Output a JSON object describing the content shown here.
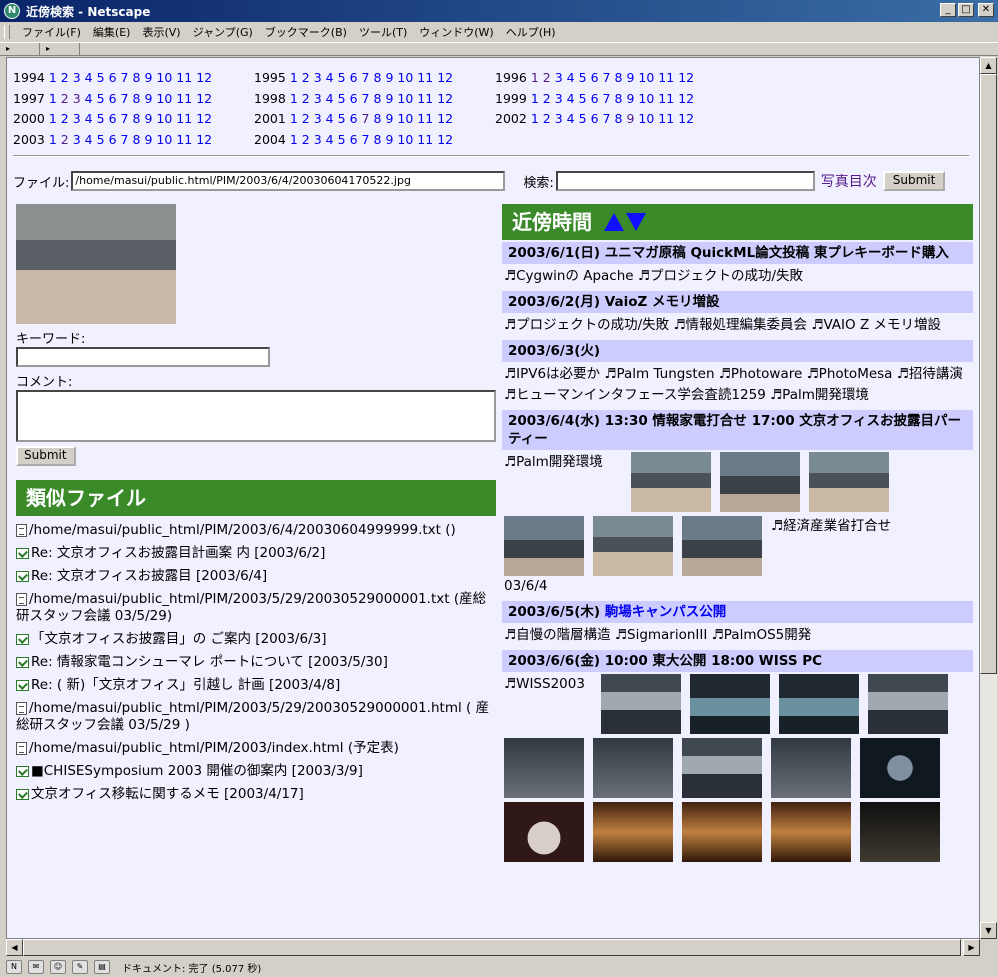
{
  "window": {
    "title": "近傍検索 - Netscape",
    "app_icon": "N"
  },
  "menu": [
    "ファイル(F)",
    "編集(E)",
    "表示(V)",
    "ジャンプ(G)",
    "ブックマーク(B)",
    "ツール(T)",
    "ウィンドウ(W)",
    "ヘルプ(H)"
  ],
  "years": [
    [
      {
        "year": "1994"
      },
      {
        "year": "1995"
      },
      {
        "year": "1996"
      }
    ],
    [
      {
        "year": "1997"
      },
      {
        "year": "1998"
      },
      {
        "year": "1999"
      }
    ],
    [
      {
        "year": "2000"
      },
      {
        "year": "2001"
      },
      {
        "year": "2002"
      }
    ],
    [
      {
        "year": "2003"
      },
      {
        "year": "2004"
      }
    ]
  ],
  "months": [
    "1",
    "2",
    "3",
    "4",
    "5",
    "6",
    "7",
    "8",
    "9",
    "10",
    "11",
    "12"
  ],
  "form": {
    "file_label": "ファイル:",
    "file_value": "/home/masui/public.html/PIM/2003/6/4/20030604170522.jpg",
    "search_label": "検索:",
    "search_value": "",
    "photo_index": "写真目次",
    "submit": "Submit"
  },
  "left": {
    "keyword_label": "キーワード:",
    "keyword_value": "",
    "comment_label": "コメント:",
    "comment_value": "",
    "submit": "Submit",
    "similar_title": "類似ファイル",
    "similar": [
      {
        "icon": "doc",
        "text": "/home/masui/public_html/PIM/2003/6/4/20030604999999.txt ()"
      },
      {
        "icon": "mail",
        "text": "Re: 文京オフィスお披露目計画案 内 [2003/6/2]"
      },
      {
        "icon": "mail",
        "text": "Re: 文京オフィスお披露目 [2003/6/4]"
      },
      {
        "icon": "doc",
        "text": "/home/masui/public_html/PIM/2003/5/29/20030529000001.txt (産総研スタッフ会議 03/5/29)"
      },
      {
        "icon": "mail",
        "text": "「文京オフィスお披露目」の ご案内 [2003/6/3]"
      },
      {
        "icon": "mail",
        "text": "Re: 情報家電コンシューマレ ポートについて [2003/5/30]"
      },
      {
        "icon": "mail",
        "text": "Re: ( 新)「文京オフィス」引越し 計画 [2003/4/8]"
      },
      {
        "icon": "doc",
        "text": "/home/masui/public_html/PIM/2003/5/29/20030529000001.html ( 産総研スタッフ会議 03/5/29 )"
      },
      {
        "icon": "doc",
        "text": "/home/masui/public_html/PIM/2003/index.html (予定表)"
      },
      {
        "icon": "mail",
        "text": "■CHISESymposium 2003 開催の御案内 [2003/3/9]"
      },
      {
        "icon": "mail",
        "text": "文京オフィス移転に関するメモ [2003/4/17]"
      }
    ]
  },
  "right": {
    "title": "近傍時間",
    "days": [
      {
        "header": "2003/6/1(日) ユニマガ原稿 QuickML論文投稿 東プレキーボード購入",
        "items": "♬Cygwinの Apache ♬プロジェクトの成功/失敗"
      },
      {
        "header": "2003/6/2(月) VaioZ メモリ増設",
        "items": "♬プロジェクトの成功/失敗 ♬情報処理編集委員会 ♬VAIO Z メモリ増設"
      },
      {
        "header": "2003/6/3(火)",
        "items": "♬IPV6は必要か ♬Palm Tungsten ♬Photoware ♬PhotoMesa ♬招待講演 ♬ヒューマンインタフェース学会査読1259 ♬Palm開発環境"
      },
      {
        "header": "2003/6/4(水) 13:30 情報家電打合せ 17:00 文京オフィスお披露目パーティー",
        "items_a": "♬Palm開発環境",
        "items_b": "♬経済産業省打合せ",
        "caption": "03/6/4"
      },
      {
        "header_a": "2003/6/5(木) ",
        "header_link": "駒場キャンパス公開",
        "items": "♬自慢の階層構造 ♬SigmarionIII ♬PalmOS5開発"
      },
      {
        "header": "2003/6/6(金) 10:00 東大公開 18:00 WISS PC",
        "items": "♬WISS2003"
      }
    ]
  },
  "status": {
    "text": "ドキュメント: 完了 (5.077 秒)"
  }
}
